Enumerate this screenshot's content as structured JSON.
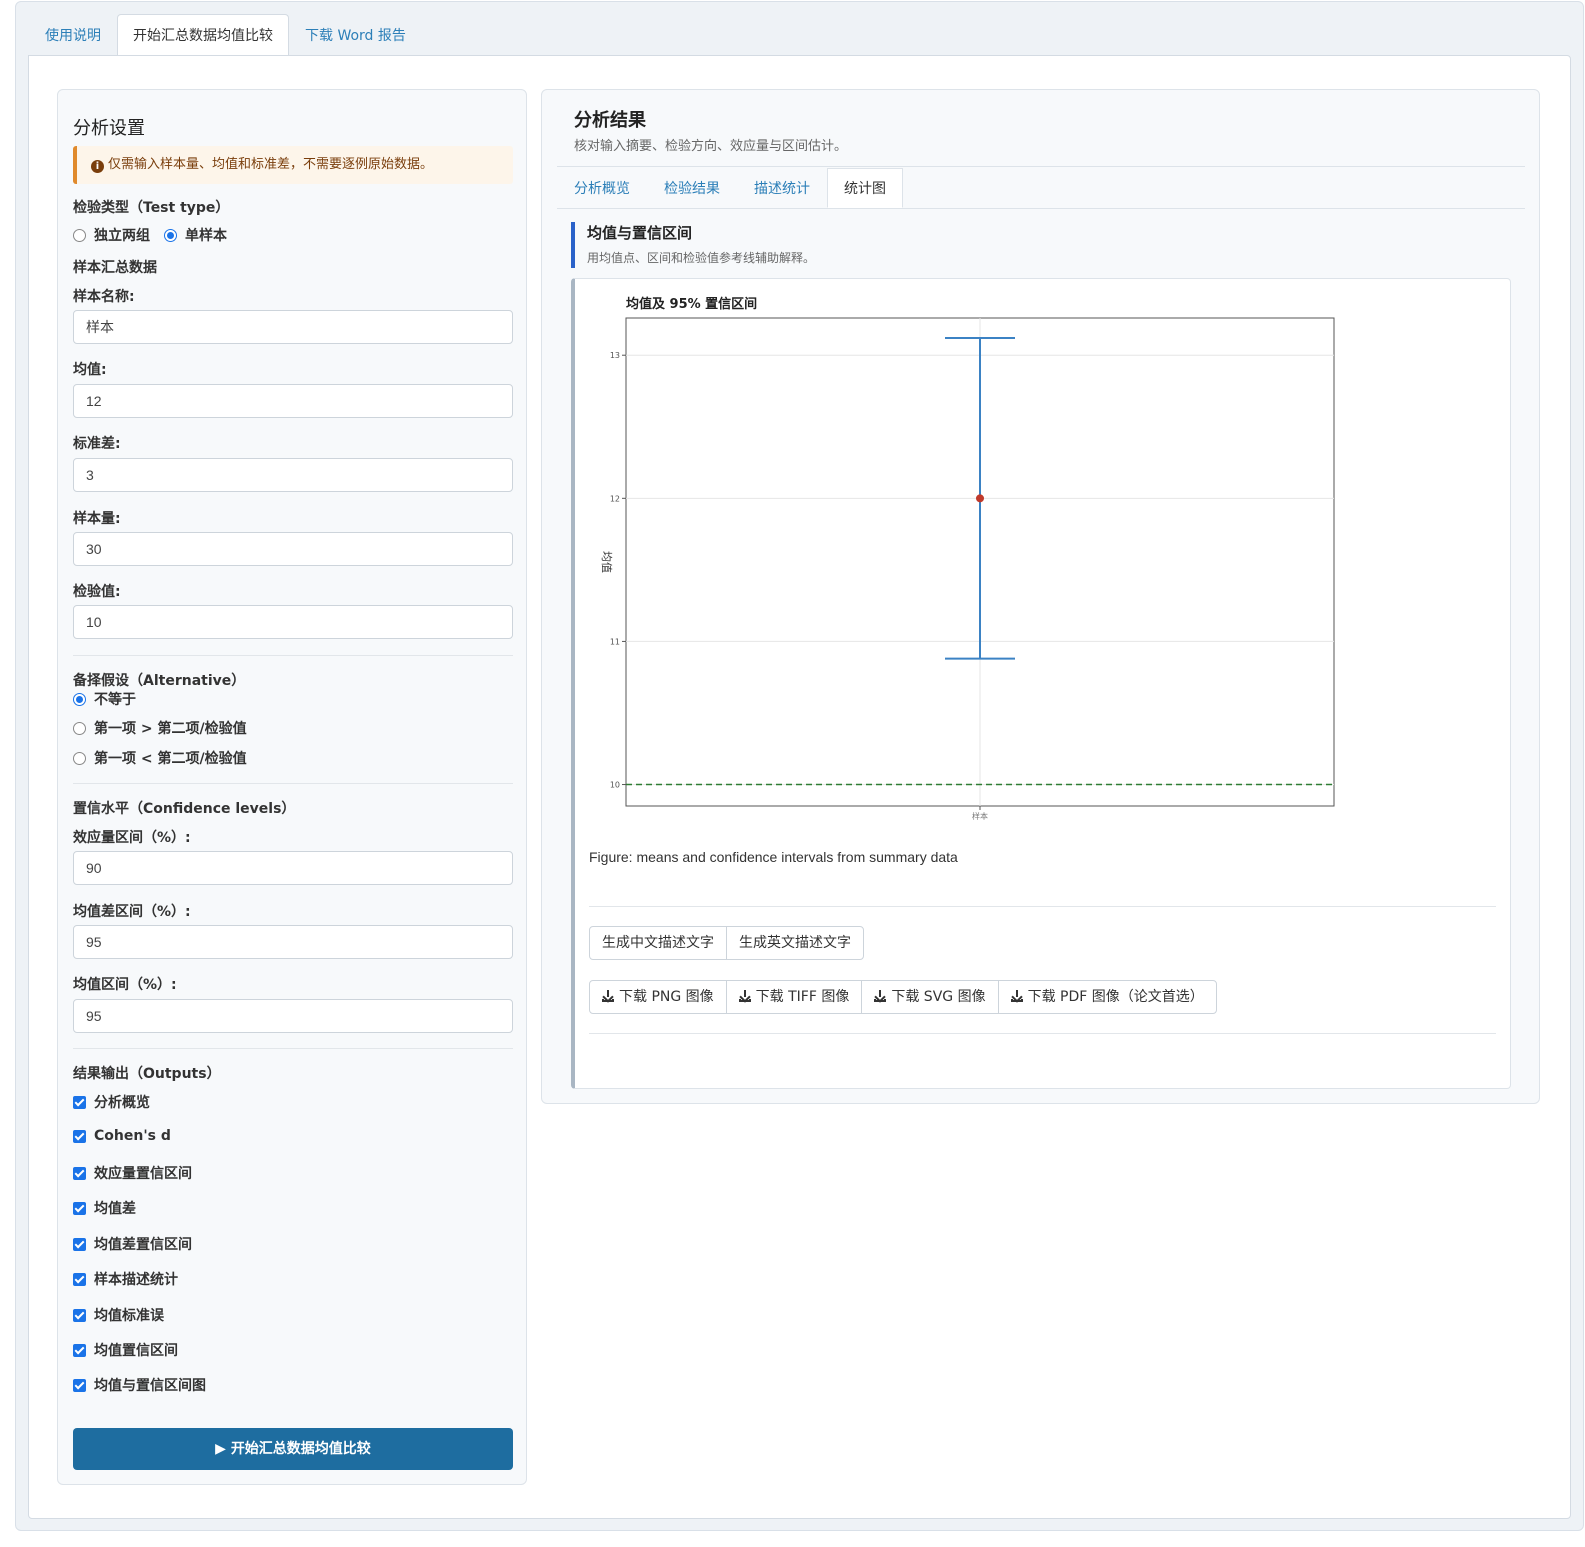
{
  "tabs": [
    "使用说明",
    "开始汇总数据均值比较",
    "下载 Word 报告"
  ],
  "sidebar": {
    "title": "分析设置",
    "notice": "仅需输入样本量、均值和标准差，不需要逐例原始数据。",
    "test_type_label": "检验类型（Test type）",
    "test_type_options": [
      "独立两组",
      "单样本"
    ],
    "test_type_selected": "单样本",
    "summary_heading": "样本汇总数据",
    "fields": [
      {
        "label": "样本名称:",
        "value": "样本"
      },
      {
        "label": "均值:",
        "value": "12"
      },
      {
        "label": "标准差:",
        "value": "3"
      },
      {
        "label": "样本量:",
        "value": "30"
      },
      {
        "label": "检验值:",
        "value": "10"
      }
    ],
    "alternative_label": "备择假设（Alternative）",
    "alternative_options": [
      "不等于",
      "第一项 > 第二项/检验值",
      "第一项 < 第二项/检验值"
    ],
    "alternative_selected": "不等于",
    "conf_label": "置信水平（Confidence levels）",
    "conf_fields": [
      {
        "label": "效应量区间（%）:",
        "value": "90"
      },
      {
        "label": "均值差区间（%）:",
        "value": "95"
      },
      {
        "label": "均值区间（%）:",
        "value": "95"
      }
    ],
    "outputs_label": "结果输出（Outputs）",
    "outputs": [
      "分析概览",
      "Cohen's d",
      "效应量置信区间",
      "均值差",
      "均值差置信区间",
      "样本描述统计",
      "均值标准误",
      "均值置信区间",
      "均值与置信区间图"
    ],
    "run_button": "开始汇总数据均值比较"
  },
  "results": {
    "title": "分析结果",
    "subtitle": "核对输入摘要、检验方向、效应量与区间估计。",
    "tabs": [
      "分析概览",
      "检验结果",
      "描述统计",
      "统计图"
    ],
    "active_tab": "统计图",
    "section_title": "均值与置信区间",
    "section_subtitle": "用均值点、区间和检验值参考线辅助解释。",
    "caption": "Figure: means and confidence intervals from summary data",
    "text_buttons": [
      "生成中文描述文字",
      "生成英文描述文字"
    ],
    "download_buttons": [
      "下载 PNG 图像",
      "下载 TIFF 图像",
      "下载 SVG 图像",
      "下载 PDF 图像（论文首选）"
    ]
  },
  "chart_data": {
    "type": "scatter",
    "title": "均值及 95% 置信区间",
    "xlabel": "",
    "ylabel": "均值",
    "categories": [
      "样本"
    ],
    "points": [
      {
        "x": "样本",
        "mean": 12,
        "ci_low": 10.88,
        "ci_high": 13.12
      }
    ],
    "reference_line": 10,
    "ylim": [
      9.85,
      13.26
    ],
    "yticks": [
      10,
      11,
      12,
      13
    ],
    "colors": {
      "interval": "#3b82c4",
      "mean": "#c0392b",
      "reference": "#2e7d32"
    },
    "grid": true
  }
}
